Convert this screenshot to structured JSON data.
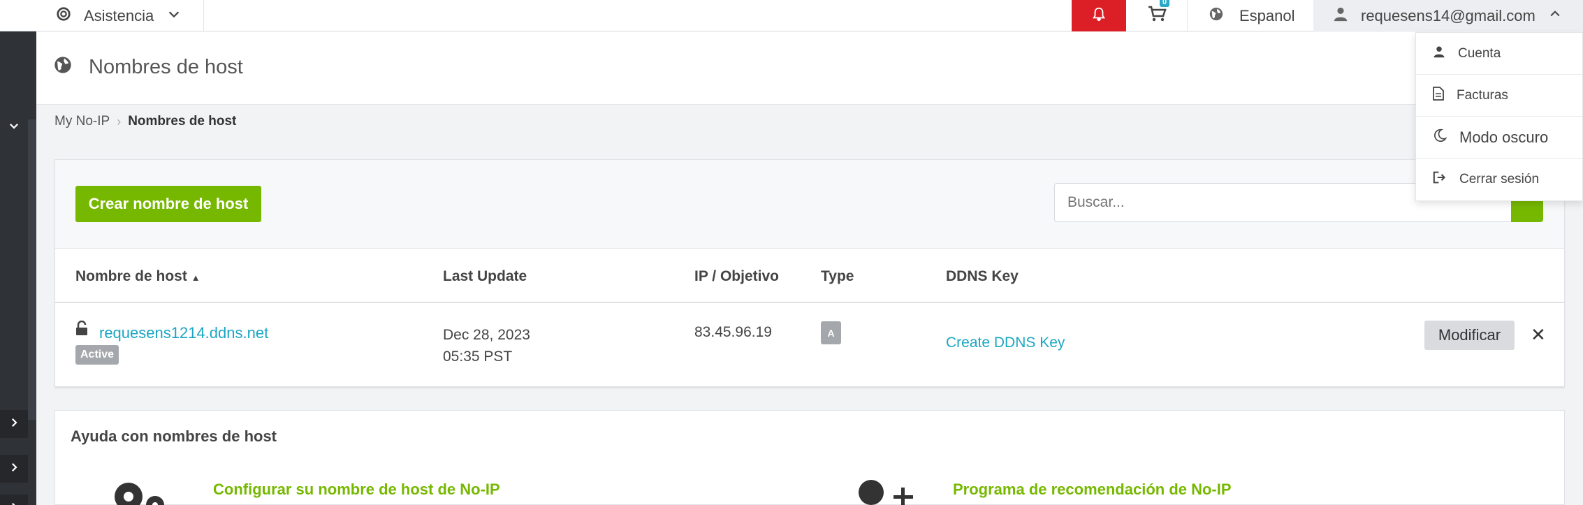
{
  "topbar": {
    "support_label": "Asistencia",
    "cart_count": "0",
    "language_label": "Espanol",
    "user_email": "requesens14@gmail.com"
  },
  "page": {
    "title": "Nombres de host"
  },
  "breadcrumb": {
    "home": "My No-IP",
    "current": "Nombres de host"
  },
  "toolbar": {
    "create_label": "Crear nombre de host",
    "search_placeholder": "Buscar..."
  },
  "table": {
    "headers": [
      "Nombre de host",
      "Last Update",
      "IP / Objetivo",
      "Type",
      "DDNS Key"
    ],
    "rows": [
      {
        "hostname": "requesens1214.ddns.net",
        "status": "Active",
        "date_line1": "Dec 28, 2023",
        "date_line2": "05:35 PST",
        "ip": "83.45.96.19",
        "type": "A",
        "ddns_action": "Create DDNS Key",
        "modify_label": "Modificar",
        "delete_symbol": "✕"
      }
    ]
  },
  "help": {
    "title": "Ayuda con nombres de host",
    "link_configure": "Configurar su nombre de host de No-IP",
    "link_referral": "Programa de recomendación de No-IP"
  },
  "user_menu": {
    "items": [
      "Cuenta",
      "Facturas",
      "Modo oscuro",
      "Cerrar sesión"
    ]
  },
  "colors": {
    "accent_green": "#76b800",
    "link_blue": "#1ba6c3",
    "alert_red": "#dc1f26",
    "sidebar_dark": "#2f3237"
  }
}
